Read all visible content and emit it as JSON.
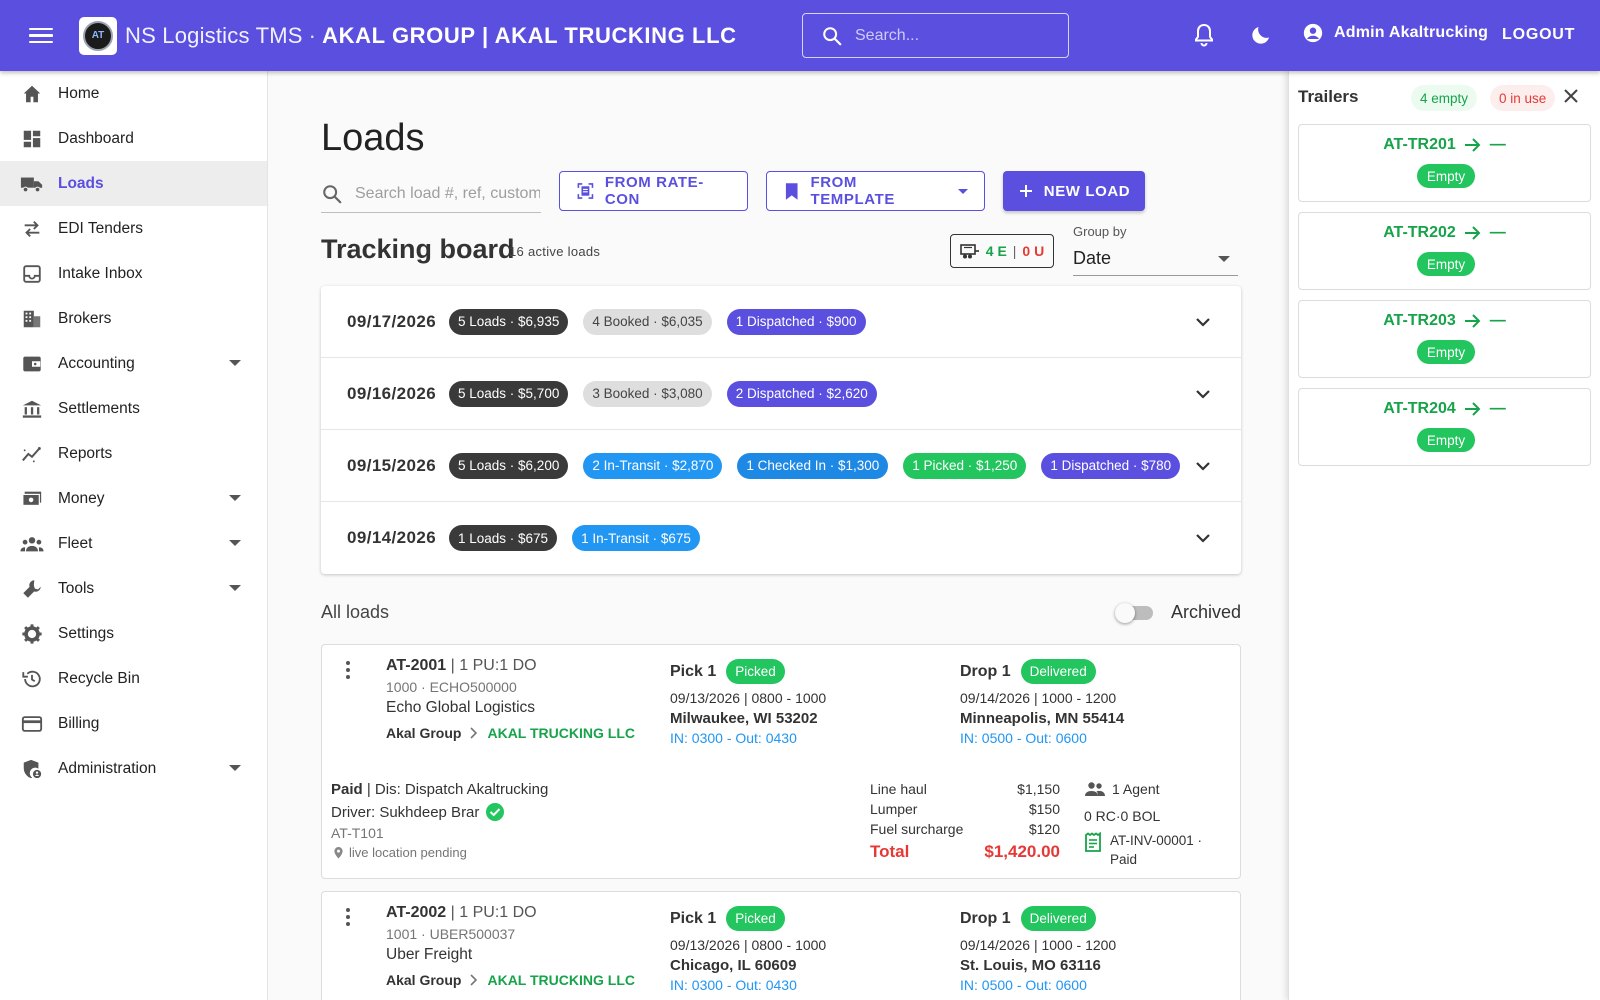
{
  "app": {
    "product": "NS Logistics TMS",
    "separator": "·",
    "org": "AKAL GROUP | AKAL TRUCKING LLC",
    "logo_text": "AT",
    "search_placeholder": "Search...",
    "user": "Admin Akaltrucking",
    "logout": "LOGOUT",
    "accent_color": "#5b4fe0"
  },
  "sidebar": {
    "items": [
      {
        "label": "Home",
        "icon": "home-icon"
      },
      {
        "label": "Dashboard",
        "icon": "dashboard-icon"
      },
      {
        "label": "Loads",
        "icon": "truck-icon",
        "active": true
      },
      {
        "label": "EDI Tenders",
        "icon": "swap-icon"
      },
      {
        "label": "Intake Inbox",
        "icon": "inbox-icon"
      },
      {
        "label": "Brokers",
        "icon": "building-icon"
      },
      {
        "label": "Accounting",
        "icon": "wallet-icon",
        "expandable": true
      },
      {
        "label": "Settlements",
        "icon": "bank-icon"
      },
      {
        "label": "Reports",
        "icon": "chart-icon"
      },
      {
        "label": "Money",
        "icon": "money-icon",
        "expandable": true
      },
      {
        "label": "Fleet",
        "icon": "people-icon",
        "expandable": true
      },
      {
        "label": "Tools",
        "icon": "wrench-icon",
        "expandable": true
      },
      {
        "label": "Settings",
        "icon": "gear-icon"
      },
      {
        "label": "Recycle Bin",
        "icon": "history-icon"
      },
      {
        "label": "Billing",
        "icon": "credit-card-icon"
      },
      {
        "label": "Administration",
        "icon": "admin-shield-icon",
        "expandable": true
      }
    ]
  },
  "loads": {
    "title": "Loads",
    "search_placeholder": "Search load #, ref, customer",
    "from_ratecon": "FROM RATE-CON",
    "from_template": "FROM TEMPLATE",
    "new_load": "NEW LOAD",
    "tracking_title": "Tracking board",
    "active_count": "16 active loads",
    "counter": {
      "e": "4 E",
      "sep": "|",
      "u": "0 U"
    },
    "group_by_label": "Group by",
    "group_by_value": "Date",
    "date_groups": [
      {
        "date": "09/17/2026",
        "chips": [
          {
            "text": "5 Loads · $6,935",
            "kind": "total"
          },
          {
            "text": "4 Booked · $6,035",
            "kind": "booked"
          },
          {
            "text": "1 Dispatched · $900",
            "kind": "dispatched"
          }
        ]
      },
      {
        "date": "09/16/2026",
        "chips": [
          {
            "text": "5 Loads · $5,700",
            "kind": "total"
          },
          {
            "text": "3 Booked · $3,080",
            "kind": "booked"
          },
          {
            "text": "2 Dispatched · $2,620",
            "kind": "dispatched"
          }
        ]
      },
      {
        "date": "09/15/2026",
        "chips": [
          {
            "text": "5 Loads · $6,200",
            "kind": "total"
          },
          {
            "text": "2 In-Transit · $2,870",
            "kind": "transit"
          },
          {
            "text": "1 Checked In · $1,300",
            "kind": "checked"
          },
          {
            "text": "1 Picked · $1,250",
            "kind": "picked"
          },
          {
            "text": "1 Dispatched · $780",
            "kind": "dispatched"
          }
        ]
      },
      {
        "date": "09/14/2026",
        "chips": [
          {
            "text": "1 Loads · $675",
            "kind": "total"
          },
          {
            "text": "1 In-Transit · $675",
            "kind": "transit"
          }
        ]
      }
    ],
    "all_loads_label": "All loads",
    "archived_label": "Archived",
    "archived_on": false,
    "cards": [
      {
        "id": "AT-2001",
        "stops_info": "| 1 PU:1 DO",
        "ref": "1000 · ECHO500000",
        "broker": "Echo Global Logistics",
        "group": "Akal Group",
        "company": "AKAL TRUCKING LLC",
        "pick": {
          "label": "Pick 1",
          "status": "Picked",
          "time": "09/13/2026 | 0800 - 1000",
          "city": "Milwaukee, WI 53202",
          "inout": "IN: 0300 - Out: 0430"
        },
        "drop": {
          "label": "Drop 1",
          "status": "Delivered",
          "time": "09/14/2026 | 1000 - 1200",
          "city": "Minneapolis, MN 55414",
          "inout": "IN: 0500 - Out: 0600"
        },
        "paid": "Paid",
        "dispatch": "| Dis: Dispatch Akaltrucking",
        "driver": "Driver: Sukhdeep Brar",
        "truck": "AT-T101",
        "location": "live location pending",
        "charges": [
          {
            "label": "Line haul",
            "value": "$1,150"
          },
          {
            "label": "Lumper",
            "value": "$150"
          },
          {
            "label": "Fuel surcharge",
            "value": "$120"
          }
        ],
        "total_label": "Total",
        "total_value": "$1,420.00",
        "agents": "1 Agent",
        "docs": "0 RC·0 BOL",
        "invoice": "AT-INV-00001 · Paid"
      },
      {
        "id": "AT-2002",
        "stops_info": "| 1 PU:1 DO",
        "ref": "1001 · UBER500037",
        "broker": "Uber Freight",
        "group": "Akal Group",
        "company": "AKAL TRUCKING LLC",
        "pick": {
          "label": "Pick 1",
          "status": "Picked",
          "time": "09/13/2026 | 0800 - 1000",
          "city": "Chicago, IL 60609",
          "inout": "IN: 0300 - Out: 0430"
        },
        "drop": {
          "label": "Drop 1",
          "status": "Delivered",
          "time": "09/14/2026 | 1000 - 1200",
          "city": "St. Louis, MO 63116",
          "inout": "IN: 0500 - Out: 0600"
        }
      }
    ]
  },
  "trailers": {
    "title": "Trailers",
    "empty_count": "4 empty",
    "in_use_count": "0 in use",
    "items": [
      {
        "name": "AT-TR201",
        "dash": "—",
        "status": "Empty"
      },
      {
        "name": "AT-TR202",
        "dash": "—",
        "status": "Empty"
      },
      {
        "name": "AT-TR203",
        "dash": "—",
        "status": "Empty"
      },
      {
        "name": "AT-TR204",
        "dash": "—",
        "status": "Empty"
      }
    ]
  }
}
